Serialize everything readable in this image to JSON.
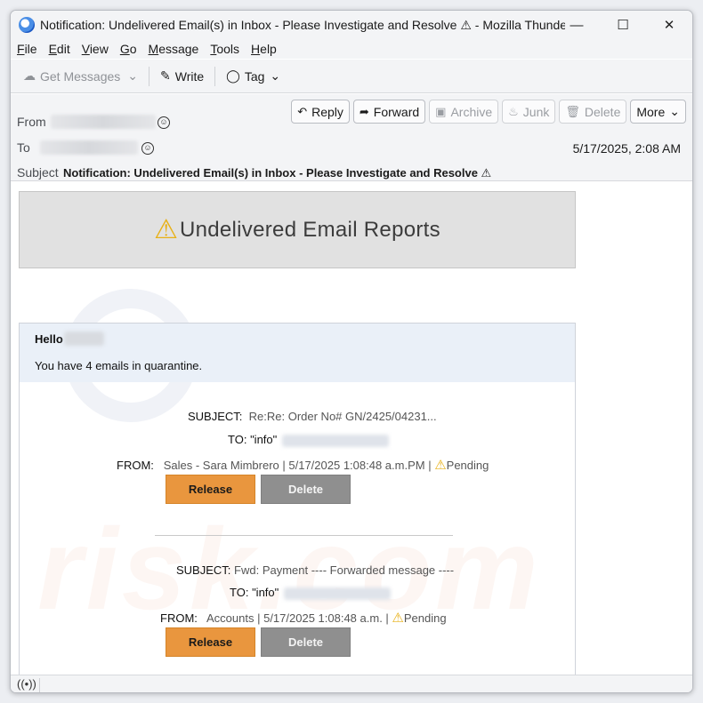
{
  "window": {
    "title": "Notification: Undelivered Email(s) in Inbox - Please Investigate and Resolve ⚠ - Mozilla Thunde...",
    "controls": {
      "minimize": "—",
      "maximize": "☐",
      "close": "✕"
    }
  },
  "menubar": [
    {
      "u": "F",
      "rest": "ile"
    },
    {
      "u": "E",
      "rest": "dit"
    },
    {
      "u": "V",
      "rest": "iew"
    },
    {
      "u": "G",
      "rest": "o"
    },
    {
      "u": "M",
      "rest": "essage"
    },
    {
      "u": "T",
      "rest": "ools"
    },
    {
      "u": "H",
      "rest": "elp"
    }
  ],
  "toolbar": {
    "get_messages": "Get Messages",
    "write": "Write",
    "tag": "Tag"
  },
  "header": {
    "from_label": "From",
    "to_label": "To",
    "subject_label": "Subject",
    "subject": "Notification: Undelivered Email(s) in Inbox - Please Investigate and Resolve ⚠",
    "date": "5/17/2025, 2:08 AM",
    "actions": {
      "reply": "Reply",
      "forward": "Forward",
      "archive": "Archive",
      "junk": "Junk",
      "delete": "Delete",
      "more": "More"
    }
  },
  "email": {
    "banner_title": "Undelivered Email Reports",
    "greeting": "Hello",
    "quarantine_text": "You have 4 emails in quarantine.",
    "messages": [
      {
        "subject_label": "SUBJECT:",
        "subject": "Re:Re: Order No# GN/2425/04231...",
        "to_label": "TO:",
        "to": "\"info\"",
        "from_label": "FROM:",
        "from": "Sales - Sara Mimbrero |  5/17/2025 1:08:48 a.m.PM |",
        "status": "Pending",
        "release": "Release",
        "delete": "Delete"
      },
      {
        "subject_label": "SUBJECT:",
        "subject": "Fwd: Payment ---- Forwarded message ----",
        "to_label": "TO:",
        "to": "\"info\"",
        "from_label": "FROM:",
        "from": "Accounts |  5/17/2025 1:08:48 a.m. |",
        "status": "Pending",
        "release": "Release",
        "delete": "Delete"
      }
    ]
  },
  "watermark": "risk.com",
  "colors": {
    "release_bg": "#e9963e",
    "delete_bg": "#8f8f8f",
    "banner_bg": "#e1e1e1",
    "card_head_bg": "#eaf0f8",
    "warning": "#e8b015"
  }
}
